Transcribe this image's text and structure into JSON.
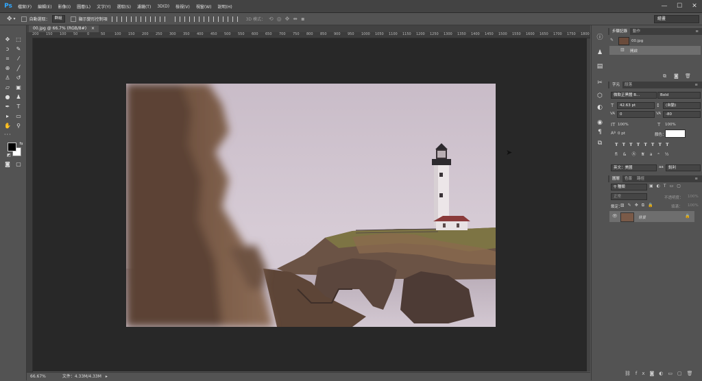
{
  "app": {
    "logo": "Ps"
  },
  "menu": [
    "檔案(F)",
    "編輯(E)",
    "影像(I)",
    "圖層(L)",
    "文字(Y)",
    "選取(S)",
    "濾鏡(T)",
    "3D(D)",
    "檢視(V)",
    "視窗(W)",
    "說明(H)"
  ],
  "window_controls": [
    "—",
    "☐",
    "✕"
  ],
  "options": {
    "auto_select_label": "自動選取：",
    "auto_select_value": "群組",
    "transform_label": "顯示變形控制項",
    "mode_3d": "3D 模式：",
    "workspace": "繪畫"
  },
  "document": {
    "tab_title": "00.jpg @ 66.7% (RGB/8#)",
    "ruler_ticks": [
      "200",
      "150",
      "100",
      "50",
      "0",
      "50",
      "100",
      "150",
      "200",
      "250",
      "300",
      "350",
      "400",
      "450",
      "500",
      "550",
      "600",
      "650",
      "700",
      "750",
      "800",
      "850",
      "900",
      "950",
      "1000",
      "1050",
      "1100",
      "1150",
      "1200",
      "1250",
      "1300",
      "1350",
      "1400",
      "1450",
      "1500",
      "1550",
      "1600",
      "1650",
      "1700",
      "1750",
      "1800"
    ]
  },
  "status": {
    "zoom": "66.67%",
    "doc_info": "文件：4.33M/4.33M"
  },
  "history_panel": {
    "tabs": [
      "步驟記錄",
      "動作"
    ],
    "snapshot_name": "00.jpg",
    "step": "開啟"
  },
  "character_panel": {
    "tabs": [
      "字元",
      "段落"
    ],
    "font_family": "微軟正黑體 B...",
    "font_style": "Bold",
    "font_size": "42.63 pt",
    "leading": "(自動)",
    "kerning": "0",
    "tracking": "-80",
    "vscale": "100%",
    "hscale": "100%",
    "baseline": "0 pt",
    "color_label": "顏色：",
    "language": "英文：美國",
    "aa": "aa",
    "aa_mode": "銳利",
    "color": "#ffffff"
  },
  "layers_panel": {
    "tabs": [
      "圖層",
      "色版",
      "路徑"
    ],
    "filter_label": "種類",
    "blend_mode": "正常",
    "opacity_label": "不透明度：",
    "opacity_value": "100%",
    "lock_label": "鎖定：",
    "fill_label": "填滿：",
    "fill_value": "100%",
    "layer_name": "背景"
  }
}
